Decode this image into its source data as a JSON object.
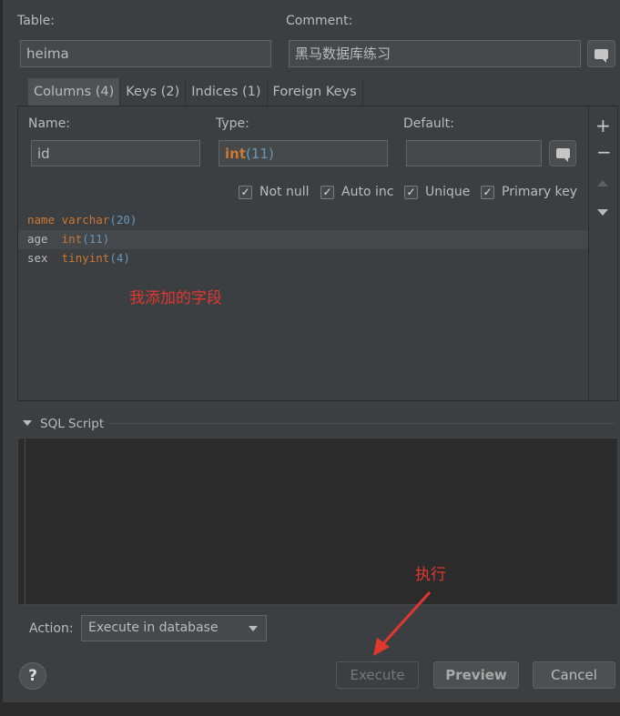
{
  "labels": {
    "table": "Table:",
    "comment": "Comment:",
    "name": "Name:",
    "type": "Type:",
    "default": "Default:",
    "sql_script": "SQL Script",
    "action": "Action:"
  },
  "fields": {
    "table_value": "heima",
    "comment_value": "黑马数据库练习",
    "name_value": "id",
    "type_keyword": "int",
    "type_num": "(11)",
    "default_value": ""
  },
  "tabs": [
    {
      "label": "Columns (4)",
      "active": true
    },
    {
      "label": "Keys (2)",
      "active": false
    },
    {
      "label": "Indices (1)",
      "active": false
    },
    {
      "label": "Foreign Keys",
      "active": false
    }
  ],
  "checkboxes": [
    {
      "label": "Not null",
      "checked": true
    },
    {
      "label": "Auto inc",
      "checked": true
    },
    {
      "label": "Unique",
      "checked": true
    },
    {
      "label": "Primary key",
      "checked": true
    }
  ],
  "columns": [
    {
      "name": "name",
      "type": "varchar",
      "args": "(20)",
      "highlight_name": true
    },
    {
      "name": "age",
      "type": "int",
      "args": "(11)",
      "highlight_name": false
    },
    {
      "name": "sex",
      "type": "tinyint",
      "args": "(4)",
      "highlight_name": false
    }
  ],
  "annotations": {
    "added_fields": "我添加的字段",
    "execute": "执行",
    "annotation_color": "#e0382e"
  },
  "action_select": {
    "value": "Execute in database"
  },
  "buttons": {
    "help": "?",
    "execute": "Execute",
    "preview": "Preview",
    "cancel": "Cancel"
  },
  "icons": {
    "add": "plus-icon",
    "remove": "minus-icon",
    "move_up": "arrow-up-icon",
    "move_down": "arrow-down-icon",
    "comment_edit": "speech-bubble-icon",
    "checkbox_check": "✓"
  },
  "colors": {
    "keyword": "#cc7832",
    "number": "#6897bb",
    "background": "#3c3f41"
  }
}
